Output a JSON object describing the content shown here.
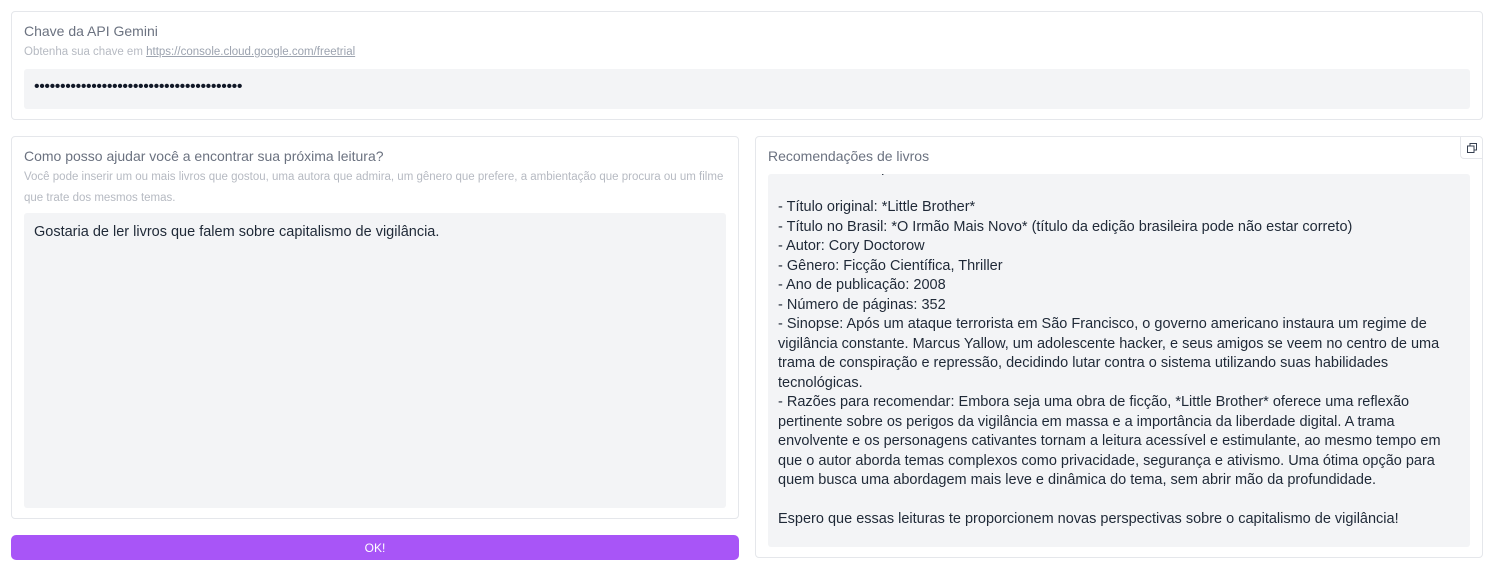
{
  "api_key": {
    "label": "Chave da API Gemini",
    "info_prefix": "Obtenha sua chave em ",
    "info_link": "https://console.cloud.google.com/freetrial",
    "value": "••••••••••••••••••••••••••••••••••••••••"
  },
  "query": {
    "label": "Como posso ajudar você a encontrar sua próxima leitura?",
    "info": "Você pode inserir um ou mais livros que gostou, uma autora que admira, um gênero que prefere, a ambientação que procura ou um filme que trate dos mesmos temas.",
    "value": "Gostaria de ler livros que falem sobre capitalismo de vigilância."
  },
  "recommendations": {
    "label": "Recomendações de livros",
    "copy_icon": "copy-icon",
    "text": "ótica humana e pessoal.\n\n- Título original: *Little Brother*\n- Título no Brasil: *O Irmão Mais Novo* (título da edição brasileira pode não estar correto)\n- Autor: Cory Doctorow\n- Gênero: Ficção Científica, Thriller\n- Ano de publicação: 2008\n- Número de páginas: 352\n- Sinopse: Após um ataque terrorista em São Francisco, o governo americano instaura um regime de vigilância constante. Marcus Yallow, um adolescente hacker, e seus amigos se veem no centro de uma trama de conspiração e repressão, decidindo lutar contra o sistema utilizando suas habilidades tecnológicas.\n- Razões para recomendar: Embora seja uma obra de ficção, *Little Brother* oferece uma reflexão pertinente sobre os perigos da vigilância em massa e a importância da liberdade digital. A trama envolvente e os personagens cativantes tornam a leitura acessível e estimulante, ao mesmo tempo em que o autor aborda temas complexos como privacidade, segurança e ativismo. Uma ótima opção para quem busca uma abordagem mais leve e dinâmica do tema, sem abrir mão da profundidade.\n\nEspero que essas leituras te proporcionem novas perspectivas sobre o capitalismo de vigilância!"
  },
  "submit": {
    "label": "OK!"
  },
  "colors": {
    "accent": "#a855f7",
    "field_bg": "#f3f4f6",
    "border": "#e5e7eb"
  }
}
